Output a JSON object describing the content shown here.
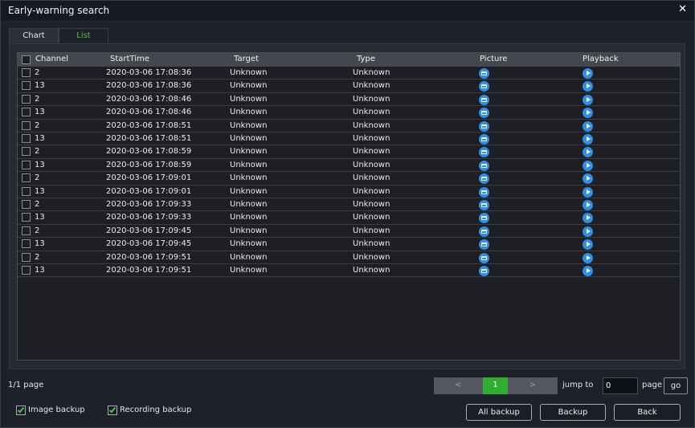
{
  "window": {
    "title": "Early-warning search",
    "close_icon": "close-icon"
  },
  "tabs": [
    {
      "label": "Chart",
      "active": false
    },
    {
      "label": "List",
      "active": true,
      "active_color": "#4cc445"
    }
  ],
  "table": {
    "columns": [
      "Channel",
      "StartTime",
      "Target",
      "Type",
      "Picture",
      "Playback"
    ],
    "rows": [
      {
        "channel": "2",
        "start_time": "2020-03-06 17:08:36",
        "target": "Unknown",
        "type": "Unknown"
      },
      {
        "channel": "13",
        "start_time": "2020-03-06 17:08:36",
        "target": "Unknown",
        "type": "Unknown"
      },
      {
        "channel": "2",
        "start_time": "2020-03-06 17:08:46",
        "target": "Unknown",
        "type": "Unknown"
      },
      {
        "channel": "13",
        "start_time": "2020-03-06 17:08:46",
        "target": "Unknown",
        "type": "Unknown"
      },
      {
        "channel": "2",
        "start_time": "2020-03-06 17:08:51",
        "target": "Unknown",
        "type": "Unknown"
      },
      {
        "channel": "13",
        "start_time": "2020-03-06 17:08:51",
        "target": "Unknown",
        "type": "Unknown"
      },
      {
        "channel": "2",
        "start_time": "2020-03-06 17:08:59",
        "target": "Unknown",
        "type": "Unknown"
      },
      {
        "channel": "13",
        "start_time": "2020-03-06 17:08:59",
        "target": "Unknown",
        "type": "Unknown"
      },
      {
        "channel": "2",
        "start_time": "2020-03-06 17:09:01",
        "target": "Unknown",
        "type": "Unknown"
      },
      {
        "channel": "13",
        "start_time": "2020-03-06 17:09:01",
        "target": "Unknown",
        "type": "Unknown"
      },
      {
        "channel": "2",
        "start_time": "2020-03-06 17:09:33",
        "target": "Unknown",
        "type": "Unknown"
      },
      {
        "channel": "13",
        "start_time": "2020-03-06 17:09:33",
        "target": "Unknown",
        "type": "Unknown"
      },
      {
        "channel": "2",
        "start_time": "2020-03-06 17:09:45",
        "target": "Unknown",
        "type": "Unknown"
      },
      {
        "channel": "13",
        "start_time": "2020-03-06 17:09:45",
        "target": "Unknown",
        "type": "Unknown"
      },
      {
        "channel": "2",
        "start_time": "2020-03-06 17:09:51",
        "target": "Unknown",
        "type": "Unknown"
      },
      {
        "channel": "13",
        "start_time": "2020-03-06 17:09:51",
        "target": "Unknown",
        "type": "Unknown"
      }
    ],
    "picture_icon": "picture-icon",
    "playback_icon": "play-icon",
    "icon_color": "#2f8ee6"
  },
  "pagination": {
    "page_info": "1/1 page",
    "prev_label": "<",
    "current_page": "1",
    "next_label": ">",
    "jump_label": "jump to",
    "jump_value": "0",
    "page_label": "page",
    "go_label": "go",
    "current_color": "#2fae2f"
  },
  "options": {
    "image_backup": {
      "label": "Image backup",
      "checked": true
    },
    "recording_backup": {
      "label": "Recording backup",
      "checked": true
    }
  },
  "buttons": {
    "all_backup": "All backup",
    "backup": "Backup",
    "back": "Back"
  }
}
